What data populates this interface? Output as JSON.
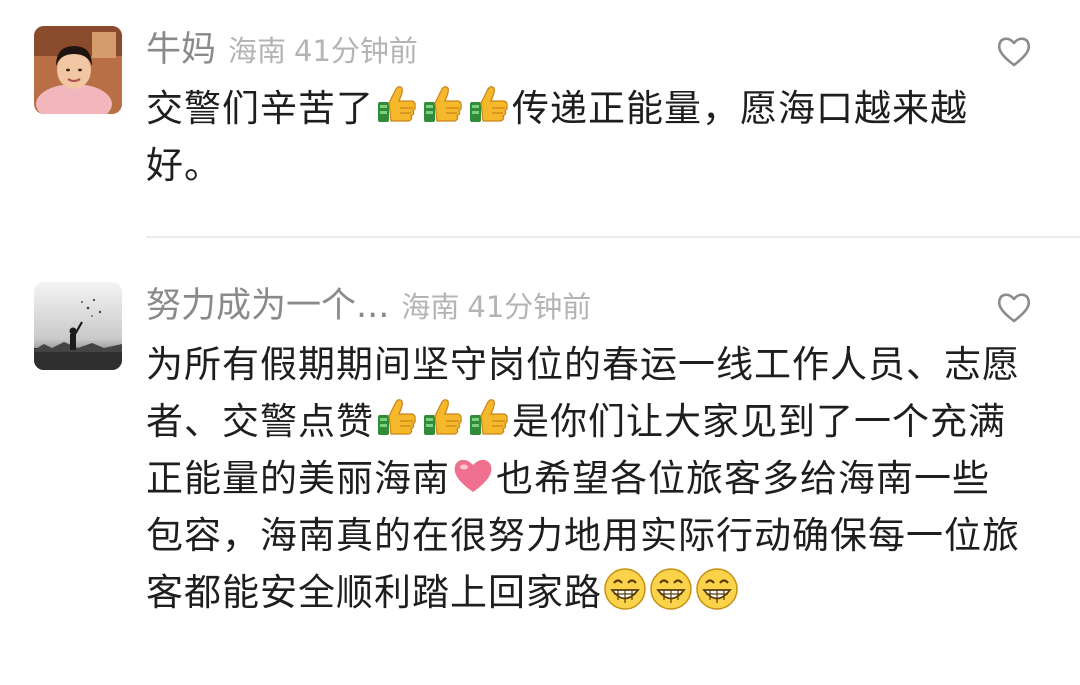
{
  "comments": [
    {
      "username": "牛妈",
      "location": "海南",
      "time": "41分钟前",
      "content_before": "交警们辛苦了",
      "content_after": "传递正能量，愿海口越来越好。",
      "emojis": [
        "thumbs-up-icon",
        "thumbs-up-icon",
        "thumbs-up-icon"
      ],
      "avatar": "user-photo-avatar"
    },
    {
      "username": "努力成为一个...",
      "location": "海南",
      "time": "41分钟前",
      "content_part1": "为所有假期期间坚守岗位的春运一线工作人员、志愿者、交警点赞",
      "content_part2": "是你们让大家见到了一个充满正能量的美丽海南",
      "content_part3": "也希望各位旅客多给海南一些包容，海南真的在很努力地用实际行动确保每一位旅客都能安全顺利踏上回家路",
      "emojis": [
        "thumbs-up-icon",
        "thumbs-up-icon",
        "thumbs-up-icon",
        "pink-heart-icon",
        "grinning-face-icon",
        "grinning-face-icon",
        "grinning-face-icon"
      ],
      "avatar": "silhouette-photo-avatar"
    }
  ],
  "colors": {
    "username": "#8a8a8a",
    "meta": "#b4b4b4",
    "text": "#1e1e1e",
    "divider": "#ececec",
    "heart": "#f07090"
  }
}
